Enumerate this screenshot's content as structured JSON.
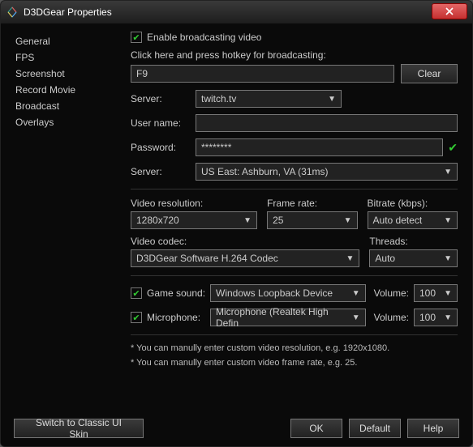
{
  "window": {
    "title": "D3DGear Properties"
  },
  "sidebar": {
    "items": [
      "General",
      "FPS",
      "Screenshot",
      "Record Movie",
      "Broadcast",
      "Overlays"
    ]
  },
  "enable": {
    "label": "Enable broadcasting video"
  },
  "hotkey": {
    "prompt": "Click here and press hotkey for broadcasting:",
    "value": "F9",
    "clear": "Clear"
  },
  "server1": {
    "label": "Server:",
    "value": "twitch.tv"
  },
  "username": {
    "label": "User name:",
    "value": ""
  },
  "password": {
    "label": "Password:",
    "value": "********"
  },
  "server2": {
    "label": "Server:",
    "value": "US East: Ashburn, VA    (31ms)"
  },
  "video": {
    "res_label": "Video resolution:",
    "res_value": "1280x720",
    "fr_label": "Frame rate:",
    "fr_value": "25",
    "br_label": "Bitrate (kbps):",
    "br_value": "Auto detect",
    "codec_label": "Video codec:",
    "codec_value": "D3DGear Software H.264 Codec",
    "threads_label": "Threads:",
    "threads_value": "Auto"
  },
  "audio": {
    "game_label": "Game sound:",
    "game_value": "Windows Loopback Device",
    "game_vol_label": "Volume:",
    "game_vol_value": "100",
    "mic_label": "Microphone:",
    "mic_value": "Microphone (Realtek High Defin",
    "mic_vol_label": "Volume:",
    "mic_vol_value": "100"
  },
  "notes": {
    "n1": "* You can manully enter custom video resolution, e.g. 1920x1080.",
    "n2": "* You can manully enter custom video frame rate, e.g. 25."
  },
  "footer": {
    "skin": "Switch to Classic UI Skin",
    "ok": "OK",
    "default": "Default",
    "help": "Help"
  }
}
